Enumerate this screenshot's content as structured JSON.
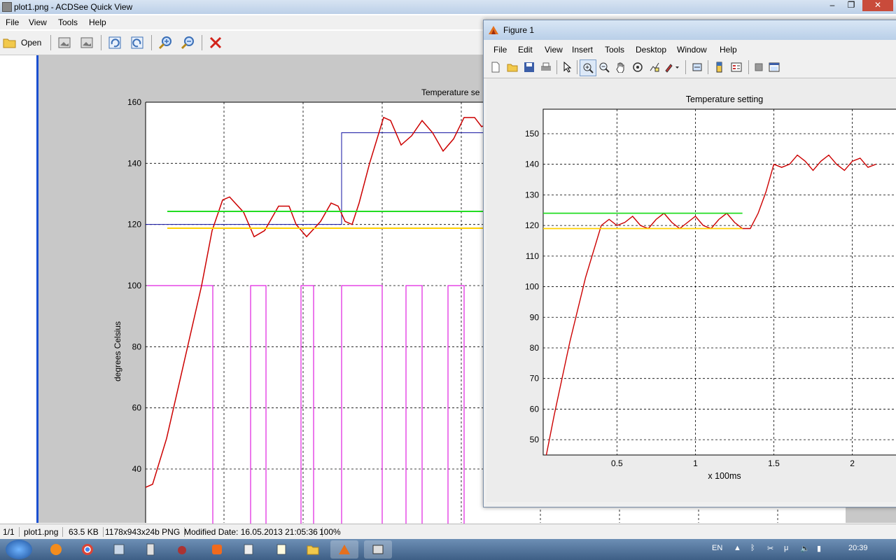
{
  "acdsee": {
    "title": "plot1.png - ACDSee Quick View",
    "menu": [
      "File",
      "View",
      "Tools",
      "Help"
    ],
    "toolbar_open": "Open",
    "status": {
      "index": "1/1",
      "filename": "plot1.png",
      "filesize": "63.5 KB",
      "dimensions": "1178x943x24b PNG",
      "modified": "Modified Date: 16.05.2013 21:05:36",
      "zoom": "100%"
    },
    "plot": {
      "title": "Temperature se",
      "ylabel": "degrees Celsius",
      "yticks": [
        "160",
        "140",
        "120",
        "100",
        "80",
        "60",
        "40"
      ]
    }
  },
  "figure": {
    "title": "Figure 1",
    "menu": [
      "File",
      "Edit",
      "View",
      "Insert",
      "Tools",
      "Desktop",
      "Window",
      "Help"
    ]
  },
  "chart_data": [
    {
      "type": "line",
      "title": "Temperature setting",
      "xlabel": "x 100ms",
      "ylabel": "",
      "xlim": [
        0.03,
        2.35
      ],
      "ylim": [
        45,
        158
      ],
      "xticks": [
        "0.5",
        "1",
        "1.5",
        "2"
      ],
      "yticks": [
        "50",
        "60",
        "70",
        "80",
        "90",
        "100",
        "110",
        "120",
        "130",
        "140",
        "150"
      ],
      "grid": true,
      "series": [
        {
          "color": "#cc0000",
          "x": [
            0.05,
            0.1,
            0.2,
            0.3,
            0.4,
            0.45,
            0.5,
            0.55,
            0.6,
            0.65,
            0.7,
            0.75,
            0.8,
            0.85,
            0.9,
            0.95,
            1.0,
            1.05,
            1.1,
            1.15,
            1.2,
            1.25,
            1.3,
            1.35,
            1.4,
            1.45,
            1.5,
            1.55,
            1.6,
            1.65,
            1.7,
            1.75,
            1.8,
            1.85,
            1.9,
            1.95,
            2.0,
            2.05,
            2.1,
            2.15
          ],
          "y": [
            45,
            58,
            82,
            103,
            120,
            122,
            120,
            121,
            123,
            120,
            119,
            122,
            124,
            121,
            119,
            121,
            123,
            120,
            119,
            122,
            124,
            121,
            119,
            119,
            124,
            131,
            140,
            139,
            140,
            143,
            141,
            138,
            141,
            143,
            140,
            138,
            141,
            142,
            139,
            140
          ]
        },
        {
          "color": "#22dd22",
          "x": [
            0.03,
            1.3
          ],
          "y": [
            124,
            124
          ]
        },
        {
          "color": "#ffd000",
          "x": [
            0.03,
            1.3
          ],
          "y": [
            119,
            119
          ]
        }
      ]
    }
  ],
  "bg_plot": {
    "red_x": [
      0,
      10,
      30,
      55,
      80,
      95,
      110,
      120,
      140,
      155,
      170,
      190,
      205,
      215,
      230,
      250,
      265,
      275,
      285,
      295,
      305,
      320,
      340,
      350,
      365,
      380,
      395,
      410,
      425,
      440,
      455,
      470,
      480,
      490
    ],
    "red_y": [
      34,
      35,
      50,
      75,
      100,
      118,
      128,
      129,
      124,
      116,
      118,
      126,
      126,
      120,
      116,
      121,
      127,
      126,
      121,
      120,
      127,
      140,
      155,
      154,
      146,
      149,
      154,
      150,
      144,
      148,
      155,
      155,
      152,
      153
    ],
    "setpoint_x": [
      0,
      280,
      280,
      490
    ],
    "setpoint_y": [
      120,
      120,
      150,
      150
    ],
    "pwm_x": [
      2,
      96,
      96,
      150,
      150,
      172,
      172,
      222,
      222,
      240,
      240,
      280,
      280,
      338,
      338,
      372,
      372,
      395,
      395,
      432,
      432,
      455,
      455,
      490
    ],
    "pwm_on": [
      1,
      1,
      0,
      0,
      1,
      1,
      0,
      0,
      1,
      1,
      0,
      0,
      1,
      1,
      0,
      0,
      1,
      1,
      0,
      0,
      1,
      1,
      0,
      0
    ]
  }
}
